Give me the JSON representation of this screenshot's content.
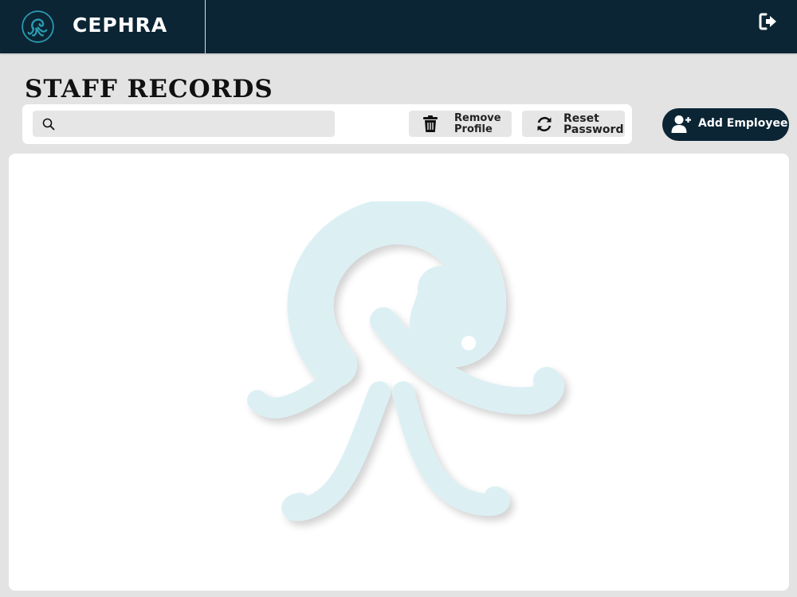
{
  "header": {
    "app_name": "CEPHRA",
    "logo_icon": "octopus-logo-icon",
    "logout_icon": "logout-icon"
  },
  "page": {
    "title": "STAFF RECORDS"
  },
  "toolbar": {
    "search": {
      "value": "",
      "placeholder": "",
      "icon": "search-icon"
    },
    "remove_profile": {
      "line1": "Remove",
      "line2": "Profile",
      "icon": "trash-icon"
    },
    "reset_password": {
      "line1": "Reset",
      "line2": "Password",
      "icon": "refresh-icon"
    }
  },
  "add_employee": {
    "label": "Add Employee",
    "icon": "user-plus-icon"
  },
  "content": {
    "watermark_icon": "octopus-watermark-icon"
  },
  "colors": {
    "navy": "#0b2535",
    "background": "#e3e3e3",
    "panel": "#ffffff",
    "control": "#e6e6e6",
    "logo_teal": "#2a9fb3",
    "watermark": "#dcf0f4"
  }
}
